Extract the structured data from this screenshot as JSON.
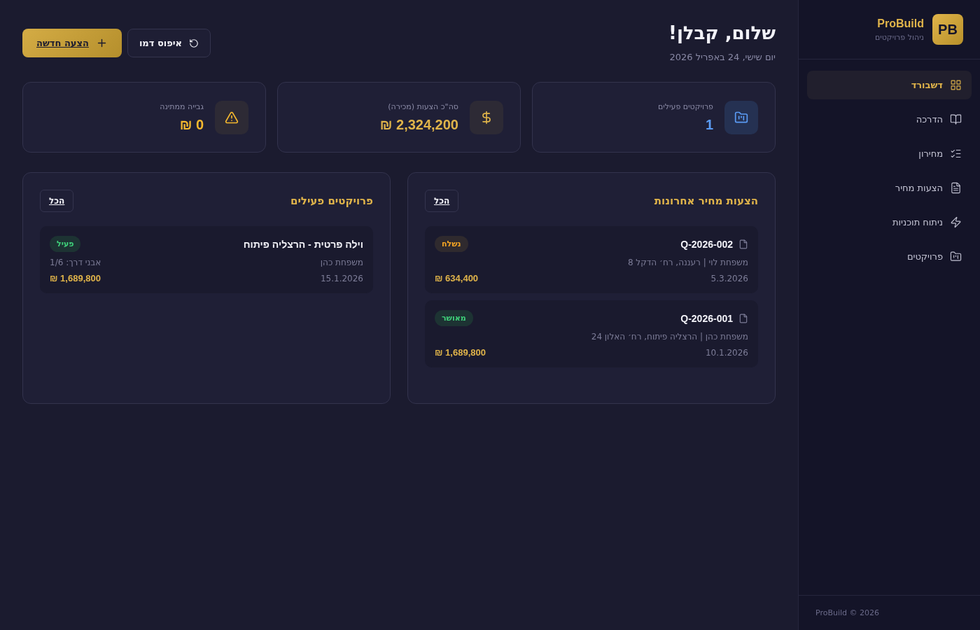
{
  "sidebar": {
    "logo": "PB",
    "brand": "ProBuild",
    "tagline": "ניהול פרויקטים",
    "items": [
      {
        "label": "דשבורד",
        "selected": true
      },
      {
        "label": "הדרכה",
        "selected": false
      },
      {
        "label": "מחירון",
        "selected": false
      },
      {
        "label": "הצעות מחיר",
        "selected": false
      },
      {
        "label": "ניתוח תוכניות",
        "selected": false
      },
      {
        "label": "פרויקטים",
        "selected": false
      }
    ],
    "footer": "ProBuild © 2026"
  },
  "header": {
    "title": "שלום, קבלן!",
    "date": "יום שישי, 24 באפריל 2026",
    "buttons": [
      {
        "label": "איפוס דמו",
        "kind": "reset"
      },
      {
        "label": "הצעה חדשה",
        "kind": "primary"
      }
    ]
  },
  "stats": [
    {
      "label": "פרויקטים פעילים",
      "value": "1",
      "kind": "projects"
    },
    {
      "label": "סה\"כ הצעות (מכירה)",
      "value": "2,324,200 ₪",
      "kind": "money"
    },
    {
      "label": "גבייה ממתינה",
      "value": "0 ₪",
      "kind": "alert"
    }
  ],
  "panels": [
    {
      "title": "הצעות מחיר אחרונות",
      "link": "הכל",
      "kind": "quotes",
      "items": [
        {
          "title": "Q-2026-002",
          "status": {
            "label": "נשלח",
            "kind": "sent"
          },
          "subtitle": "משפחת לוי | רעננה, רח׳ הדקל 8",
          "date": "5.3.2026",
          "amount": "634,400 ₪"
        },
        {
          "title": "Q-2026-001",
          "status": {
            "label": "מאושר",
            "kind": "approved"
          },
          "subtitle": "משפחת כהן | הרצליה פיתוח, רח׳ האלון 24",
          "date": "10.1.2026",
          "amount": "1,689,800 ₪"
        }
      ]
    },
    {
      "title": "פרויקטים פעילים",
      "link": "הכל",
      "kind": "projects",
      "items": [
        {
          "title": "וילה פרטית - הרצליה פיתוח",
          "status": {
            "label": "פעיל",
            "kind": "approved"
          },
          "subtitle": "משפחת כהן",
          "progress": "אבני דרך: 1/6",
          "date": "15.1.2026",
          "amount": "1,689,800 ₪"
        }
      ]
    }
  ]
}
